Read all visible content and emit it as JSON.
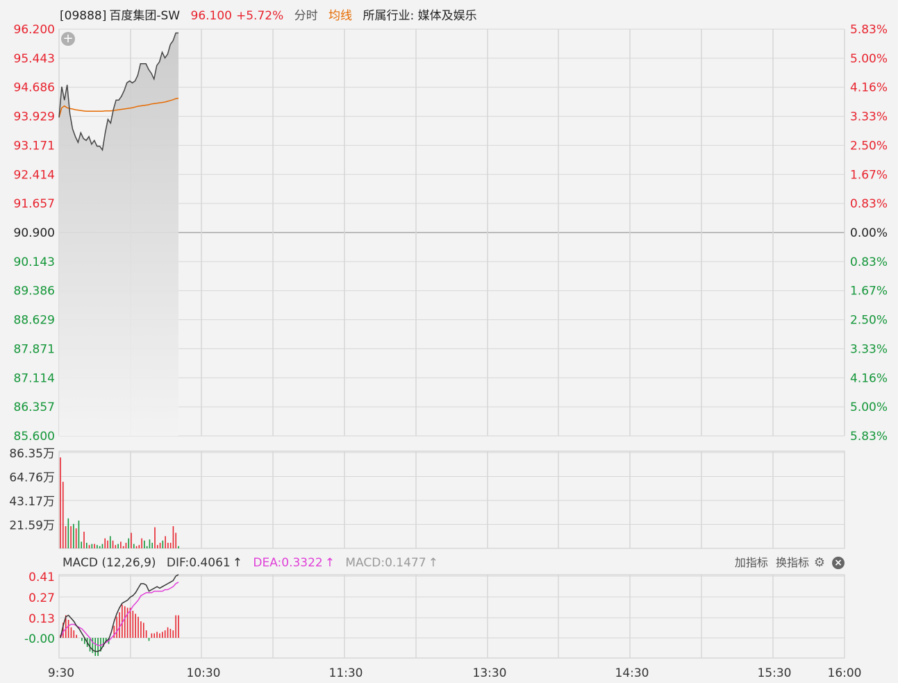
{
  "header": {
    "stock_code": "[09888]",
    "stock_name": "百度集团-SW",
    "price": "96.100",
    "change_pct": "+5.72%",
    "tab_intraday": "分时",
    "tab_avg": "均线",
    "industry": "所属行业: 媒体及娱乐"
  },
  "macd_header": {
    "title": "MACD (12,26,9)",
    "dif": "DIF:0.4061",
    "dea": "DEA:0.3322",
    "macd": "MACD:0.1477",
    "arrow": "↑"
  },
  "tools": {
    "add_indicator": "加指标",
    "switch_indicator": "换指标"
  },
  "colors": {
    "up": "#e8232e",
    "down": "#139638",
    "neutral": "#222222",
    "price_line": "#444444",
    "avg_line": "#e66a00",
    "dea_line": "#e040d8",
    "macd_gray": "#999999"
  },
  "chart_data": [
    {
      "type": "line",
      "name": "price",
      "y_left_ticks": [
        "96.200",
        "95.443",
        "94.686",
        "93.929",
        "93.171",
        "92.414",
        "91.657",
        "90.900",
        "90.143",
        "89.386",
        "88.629",
        "87.871",
        "87.114",
        "86.357",
        "85.600"
      ],
      "y_right_ticks": [
        "5.83%",
        "5.00%",
        "4.16%",
        "3.33%",
        "2.50%",
        "1.67%",
        "0.83%",
        "0.00%",
        "0.83%",
        "1.67%",
        "2.50%",
        "3.33%",
        "4.16%",
        "5.00%",
        "5.83%"
      ],
      "ylim": [
        85.6,
        96.2
      ],
      "prev_close": 90.9,
      "x_ticks": [
        "9:30",
        "10:30",
        "11:30",
        "13:30",
        "14:30",
        "15:30",
        "16:00"
      ],
      "price": [
        93.9,
        94.7,
        94.35,
        94.75,
        94.0,
        93.6,
        93.4,
        93.25,
        93.5,
        93.35,
        93.3,
        93.4,
        93.2,
        93.3,
        93.15,
        93.15,
        93.05,
        93.5,
        93.85,
        93.75,
        94.1,
        94.35,
        94.35,
        94.45,
        94.6,
        94.8,
        94.85,
        94.8,
        94.85,
        95.0,
        95.3,
        95.3,
        95.3,
        95.15,
        95.05,
        94.9,
        95.25,
        95.35,
        95.6,
        95.45,
        95.55,
        95.8,
        95.9,
        96.1,
        96.1
      ],
      "avg": [
        93.9,
        94.15,
        94.2,
        94.15,
        94.13,
        94.12,
        94.1,
        94.09,
        94.08,
        94.07,
        94.06,
        94.06,
        94.06,
        94.06,
        94.06,
        94.06,
        94.06,
        94.07,
        94.07,
        94.07,
        94.08,
        94.09,
        94.1,
        94.11,
        94.12,
        94.13,
        94.14,
        94.15,
        94.17,
        94.19,
        94.2,
        94.21,
        94.22,
        94.23,
        94.25,
        94.26,
        94.27,
        94.28,
        94.29,
        94.3,
        94.32,
        94.34,
        94.36,
        94.39,
        94.4
      ]
    },
    {
      "type": "bar",
      "name": "volume",
      "y_ticks": [
        "86.35万",
        "64.76万",
        "43.17万",
        "21.59万"
      ],
      "ylim": [
        0,
        86.35
      ],
      "values": [
        82,
        60,
        20,
        27,
        20,
        22,
        18,
        25,
        6,
        15,
        5,
        3,
        4,
        4,
        3,
        2,
        4,
        9,
        7,
        11,
        7,
        3,
        4,
        6,
        2,
        5,
        9,
        14,
        4,
        2,
        3,
        9,
        7,
        2,
        8,
        5,
        19,
        3,
        5,
        7,
        11,
        5,
        5,
        20,
        14,
        2
      ],
      "up": [
        1,
        1,
        1,
        0,
        1,
        0,
        1,
        0,
        0,
        1,
        0,
        1,
        0,
        1,
        0,
        0,
        0,
        1,
        1,
        0,
        1,
        1,
        0,
        1,
        1,
        1,
        0,
        1,
        0,
        1,
        1,
        1,
        0,
        0,
        0,
        0,
        1,
        1,
        1,
        0,
        1,
        1,
        1,
        1,
        1,
        0
      ]
    },
    {
      "type": "bar",
      "name": "macd",
      "y_ticks": [
        "0.41",
        "0.27",
        "0.13",
        "-0.00"
      ],
      "ylim": [
        -0.13,
        0.41
      ],
      "hist": [
        0.02,
        0.1,
        0.15,
        0.12,
        0.07,
        0.05,
        0.02,
        0.0,
        -0.02,
        -0.04,
        -0.06,
        -0.09,
        -0.1,
        -0.12,
        -0.12,
        -0.09,
        -0.06,
        -0.03,
        -0.04,
        0.0,
        0.08,
        0.14,
        0.17,
        0.22,
        0.21,
        0.2,
        0.2,
        0.18,
        0.16,
        0.14,
        0.11,
        0.1,
        0.05,
        -0.02,
        0.03,
        0.03,
        0.04,
        0.03,
        0.04,
        0.05,
        0.07,
        0.06,
        0.05,
        0.15,
        0.15
      ],
      "dif": [
        0.0,
        0.08,
        0.14,
        0.15,
        0.13,
        0.11,
        0.08,
        0.06,
        0.03,
        0.0,
        -0.03,
        -0.06,
        -0.08,
        -0.09,
        -0.09,
        -0.08,
        -0.05,
        -0.02,
        -0.01,
        0.04,
        0.11,
        0.16,
        0.2,
        0.23,
        0.24,
        0.25,
        0.27,
        0.28,
        0.3,
        0.33,
        0.36,
        0.36,
        0.35,
        0.31,
        0.32,
        0.33,
        0.34,
        0.33,
        0.34,
        0.35,
        0.36,
        0.37,
        0.38,
        0.41,
        0.42
      ],
      "dea": [
        0.0,
        0.04,
        0.06,
        0.08,
        0.09,
        0.09,
        0.08,
        0.07,
        0.06,
        0.04,
        0.02,
        0.0,
        -0.03,
        -0.04,
        -0.05,
        -0.05,
        -0.04,
        -0.03,
        -0.02,
        0.0,
        0.02,
        0.04,
        0.07,
        0.1,
        0.13,
        0.16,
        0.18,
        0.21,
        0.23,
        0.25,
        0.28,
        0.29,
        0.3,
        0.3,
        0.3,
        0.31,
        0.31,
        0.31,
        0.31,
        0.32,
        0.32,
        0.33,
        0.34,
        0.36,
        0.37
      ]
    }
  ]
}
